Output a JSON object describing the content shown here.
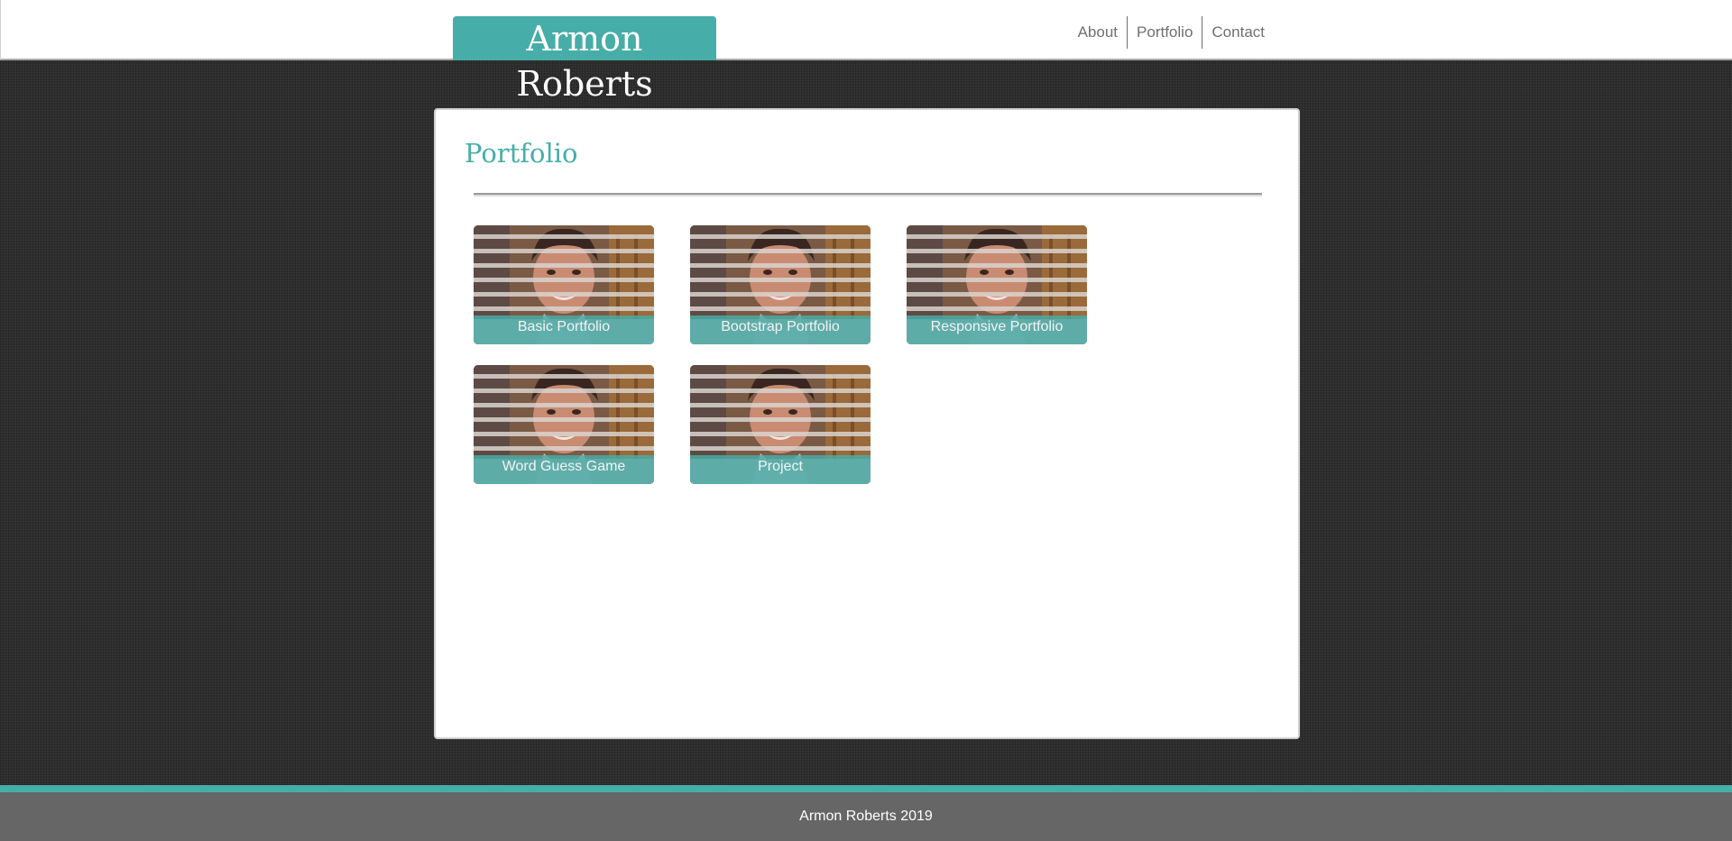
{
  "header": {
    "brand": "Armon Roberts",
    "nav": [
      {
        "label": "About"
      },
      {
        "label": "Portfolio"
      },
      {
        "label": "Contact"
      }
    ]
  },
  "main": {
    "title": "Portfolio",
    "tiles": [
      {
        "caption": "Basic Portfolio"
      },
      {
        "caption": "Bootstrap Portfolio"
      },
      {
        "caption": "Responsive Portfolio"
      },
      {
        "caption": "Word Guess Game"
      },
      {
        "caption": "Project"
      }
    ]
  },
  "footer": {
    "text": "Armon Roberts 2019"
  },
  "colors": {
    "accent": "#47ada8",
    "footer_bg": "#666666",
    "page_bg": "#2e2e2e"
  }
}
